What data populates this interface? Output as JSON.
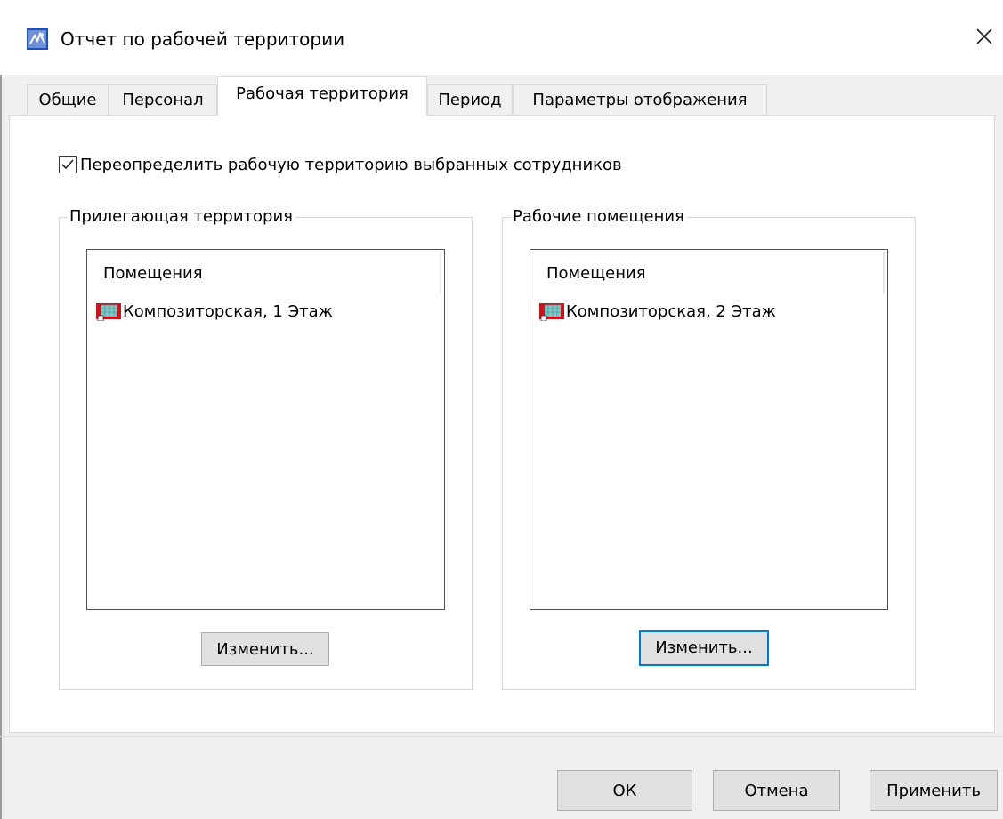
{
  "window": {
    "title": "Отчет по рабочей территории",
    "icon": "app-report-icon",
    "close_label": "✕"
  },
  "tabs": [
    {
      "label": "Общие",
      "active": false
    },
    {
      "label": "Персонал",
      "active": false
    },
    {
      "label": "Рабочая территория",
      "active": true
    },
    {
      "label": "Период",
      "active": false
    },
    {
      "label": "Параметры отображения",
      "active": false
    }
  ],
  "override_checkbox": {
    "label": "Переопределить рабочую территорию выбранных сотрудников",
    "checked": true
  },
  "adjacent": {
    "legend": "Прилегающая территория",
    "column_header": "Помещения",
    "items": [
      "Композиторская, 1 Этаж"
    ],
    "change_button": "Изменить..."
  },
  "workrooms": {
    "legend": "Рабочие помещения",
    "column_header": "Помещения",
    "items": [
      "Композиторская, 2 Этаж"
    ],
    "change_button": "Изменить..."
  },
  "footer": {
    "ok": "ОК",
    "cancel": "Отмена",
    "apply": "Применить"
  },
  "colors": {
    "focus_border": "#0078d7",
    "room_icon_red": "#c8141e",
    "room_icon_teal": "#7fc7c7"
  }
}
